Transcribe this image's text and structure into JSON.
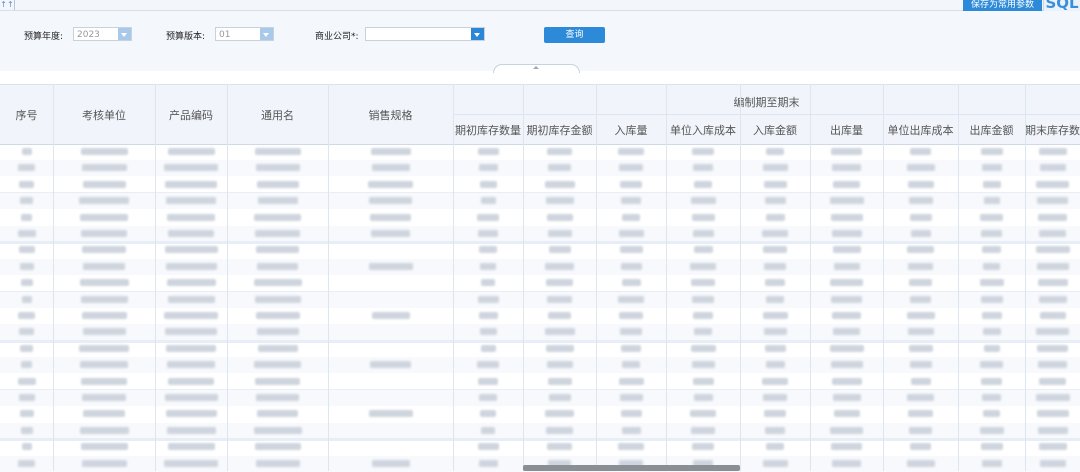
{
  "topbar": {
    "link_label": "保存为常用参数",
    "logo_text": "SQL"
  },
  "filters": {
    "year_label": "预算年度:",
    "year_value": "2023",
    "version_label": "预算版本:",
    "version_value": "01",
    "company_label": "商业公司*:",
    "company_value": "",
    "query_label": "查询"
  },
  "table": {
    "group_header": "编制期至期末",
    "col_seq": "序号",
    "col_unit": "考核单位",
    "col_code": "产品编码",
    "col_name": "通用名",
    "col_spec": "销售规格",
    "sub_headers": [
      "期初库存数量",
      "期初库存金额",
      "入库量",
      "单位入库成本",
      "入库金额",
      "出库量",
      "单位出库成本",
      "出库金额",
      "期末库存数"
    ]
  },
  "colors": {
    "accent": "#2d8ad8",
    "header_bg": "#f1f5fb",
    "filter_bg": "#f4f7fc"
  }
}
